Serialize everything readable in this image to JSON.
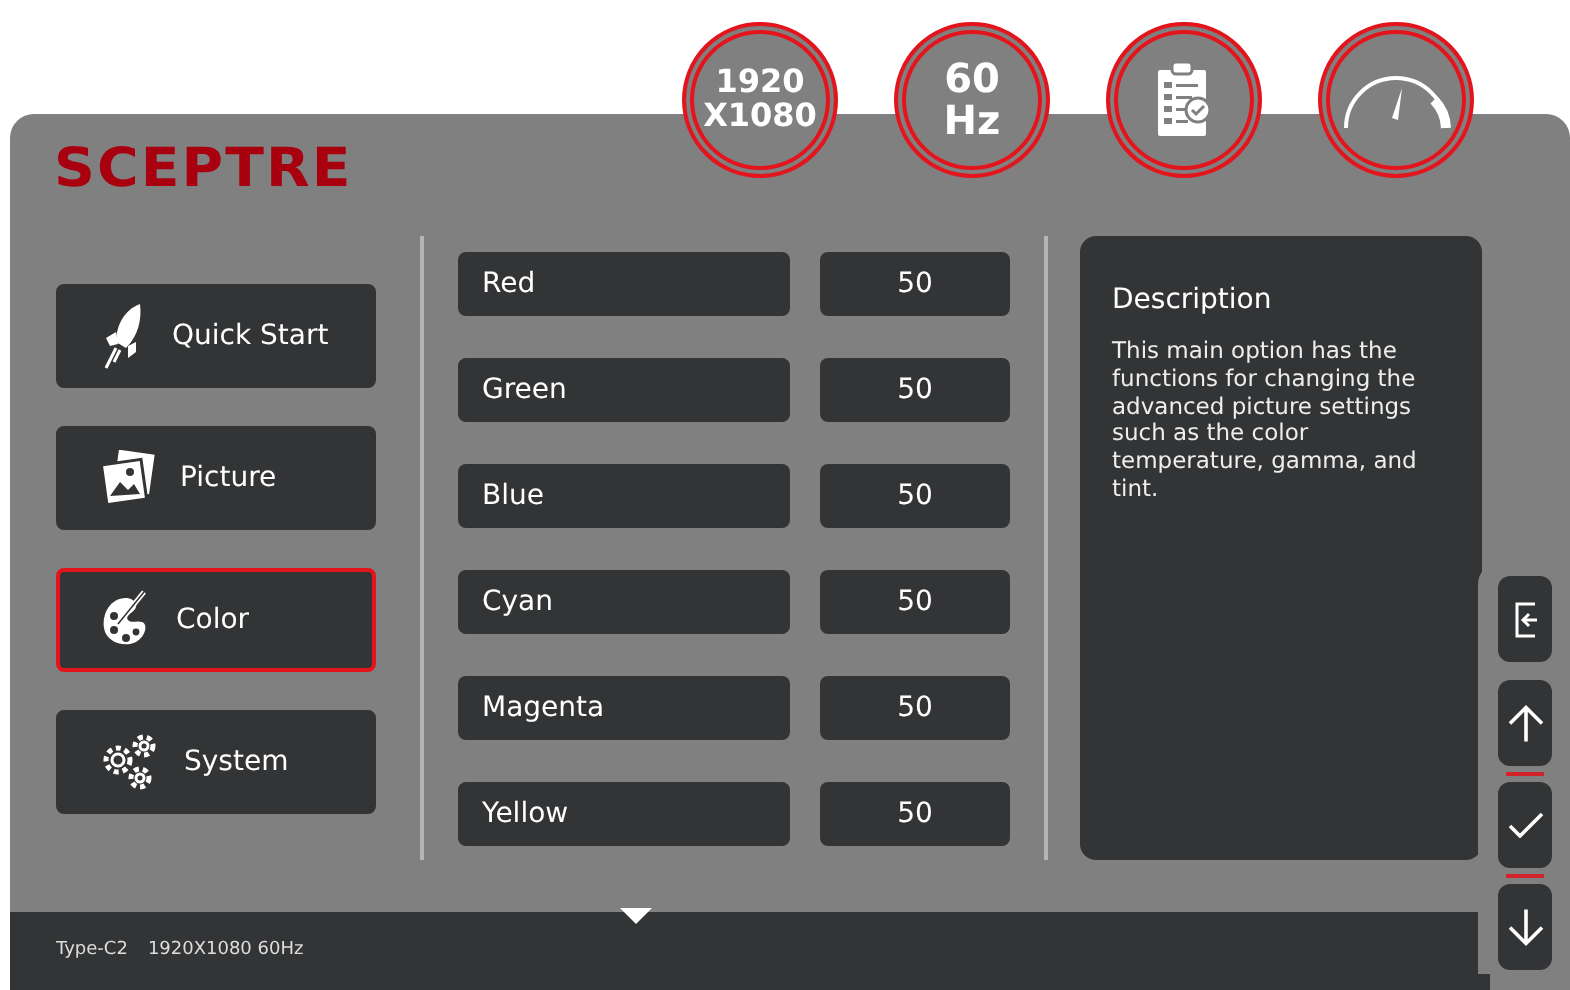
{
  "header_badges": [
    {
      "kind": "text",
      "lines": [
        "1920",
        "X1080"
      ]
    },
    {
      "kind": "text",
      "lines": [
        "60",
        "Hz"
      ]
    },
    {
      "kind": "checklist"
    },
    {
      "kind": "gauge"
    }
  ],
  "logo": "SCEPTRE",
  "menu": [
    {
      "label": "Quick Start",
      "kind": "rocket",
      "selected": false
    },
    {
      "label": "Picture",
      "kind": "photos",
      "selected": false
    },
    {
      "label": "Color",
      "kind": "palette",
      "selected": true
    },
    {
      "label": "System",
      "kind": "gears",
      "selected": false
    }
  ],
  "settings": [
    {
      "label": "Red",
      "value": "50"
    },
    {
      "label": "Green",
      "value": "50"
    },
    {
      "label": "Blue",
      "value": "50"
    },
    {
      "label": "Cyan",
      "value": "50"
    },
    {
      "label": "Magenta",
      "value": "50"
    },
    {
      "label": "Yellow",
      "value": "50"
    }
  ],
  "description": {
    "title": "Description",
    "text": "This main option has the functions for changing the advanced picture settings such as the color temperature, gamma, and tint."
  },
  "side_buttons": [
    {
      "kind": "exit"
    },
    {
      "kind": "up"
    },
    {
      "kind": "ok"
    },
    {
      "kind": "down"
    }
  ],
  "status_bar": {
    "input": "Type-C2",
    "mode": "1920X1080 60Hz"
  }
}
